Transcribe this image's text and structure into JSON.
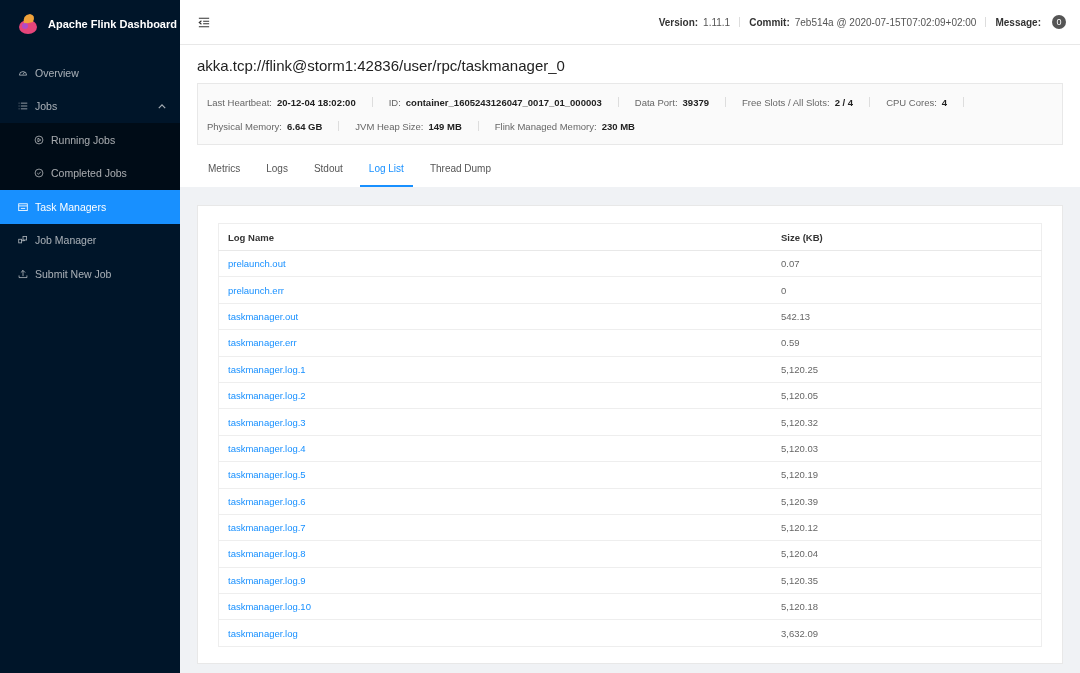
{
  "sidebar": {
    "title": "Apache Flink Dashboard",
    "items": [
      {
        "label": "Overview",
        "selected": false
      },
      {
        "label": "Jobs",
        "selected": false,
        "expanded": true,
        "children": [
          {
            "label": "Running Jobs",
            "selected": false
          },
          {
            "label": "Completed Jobs",
            "selected": false
          }
        ]
      },
      {
        "label": "Task Managers",
        "selected": true
      },
      {
        "label": "Job Manager",
        "selected": false
      },
      {
        "label": "Submit New Job",
        "selected": false
      }
    ]
  },
  "header": {
    "fields": [
      {
        "label": "Version:",
        "value": "1.11.1"
      },
      {
        "label": "Commit:",
        "value": "7eb514a @ 2020-07-15T07:02:09+02:00"
      },
      {
        "label": "Message:",
        "badge": "0"
      }
    ]
  },
  "title": "akka.tcp://flink@storm1:42836/user/rpc/taskmanager_0",
  "info": [
    [
      {
        "label": "Last Heartbeat:",
        "value": "20-12-04 18:02:00"
      },
      {
        "label": "ID:",
        "value": "container_1605243126047_0017_01_000003"
      },
      {
        "label": "Data Port:",
        "value": "39379"
      },
      {
        "label": "Free Slots / All Slots:",
        "value": "2 / 4"
      },
      {
        "label": "CPU Cores:",
        "value": "4"
      }
    ],
    [
      {
        "label": "Physical Memory:",
        "value": "6.64 GB"
      },
      {
        "label": "JVM Heap Size:",
        "value": "149 MB"
      },
      {
        "label": "Flink Managed Memory:",
        "value": "230 MB"
      }
    ]
  ],
  "tabs": [
    {
      "label": "Metrics",
      "selected": false
    },
    {
      "label": "Logs",
      "selected": false
    },
    {
      "label": "Stdout",
      "selected": false
    },
    {
      "label": "Log List",
      "selected": true
    },
    {
      "label": "Thread Dump",
      "selected": false
    }
  ],
  "table": {
    "columns": [
      "Log Name",
      "Size (KB)"
    ],
    "rows": [
      [
        "prelaunch.out",
        "0.07"
      ],
      [
        "prelaunch.err",
        "0"
      ],
      [
        "taskmanager.out",
        "542.13"
      ],
      [
        "taskmanager.err",
        "0.59"
      ],
      [
        "taskmanager.log.1",
        "5,120.25"
      ],
      [
        "taskmanager.log.2",
        "5,120.05"
      ],
      [
        "taskmanager.log.3",
        "5,120.32"
      ],
      [
        "taskmanager.log.4",
        "5,120.03"
      ],
      [
        "taskmanager.log.5",
        "5,120.19"
      ],
      [
        "taskmanager.log.6",
        "5,120.39"
      ],
      [
        "taskmanager.log.7",
        "5,120.12"
      ],
      [
        "taskmanager.log.8",
        "5,120.04"
      ],
      [
        "taskmanager.log.9",
        "5,120.35"
      ],
      [
        "taskmanager.log.10",
        "5,120.18"
      ],
      [
        "taskmanager.log",
        "3,632.09"
      ]
    ]
  }
}
